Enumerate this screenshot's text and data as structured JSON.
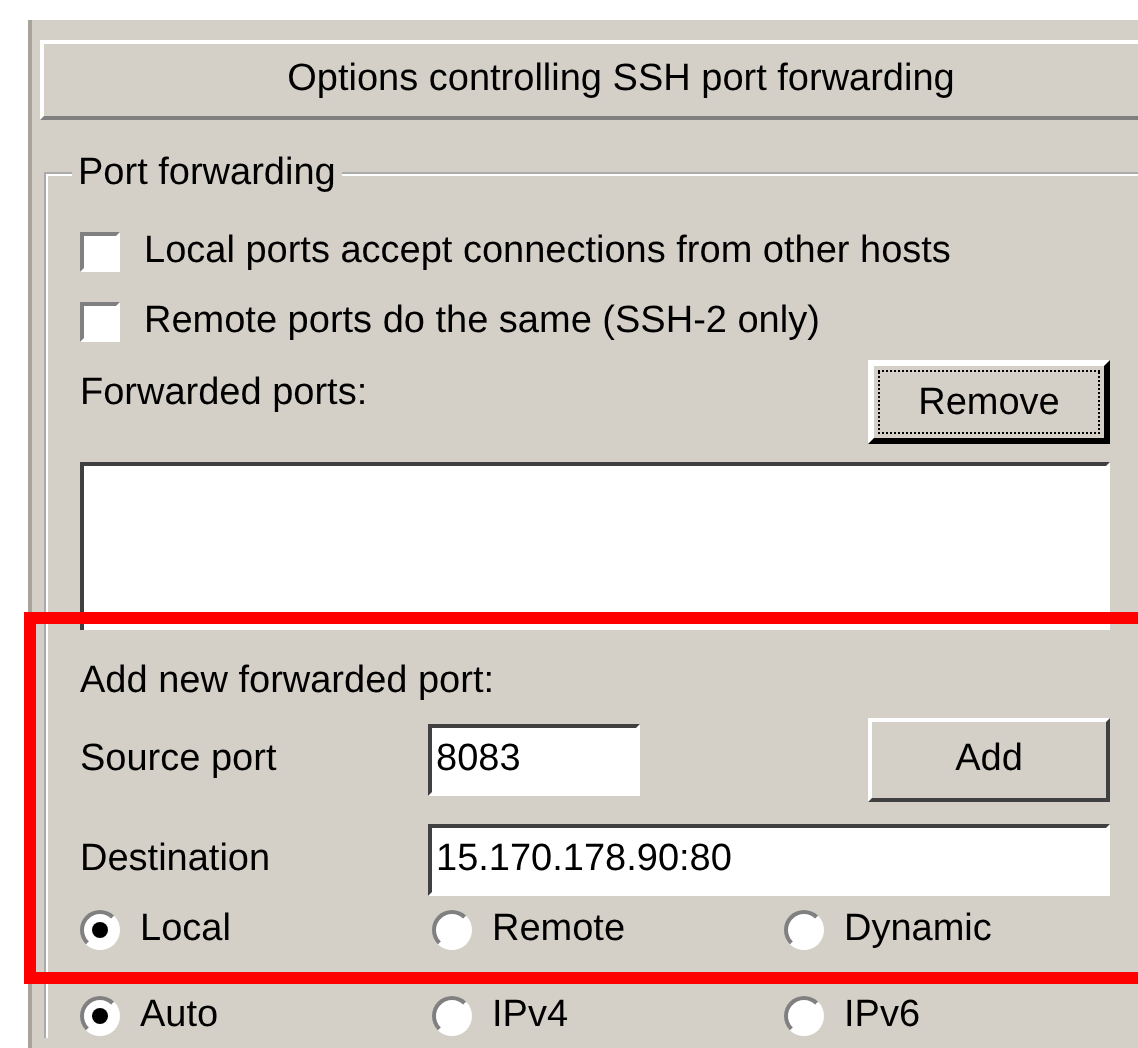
{
  "header": {
    "title": "Options controlling SSH port forwarding"
  },
  "port_forwarding": {
    "legend": "Port forwarding",
    "checkboxes": [
      {
        "label": "Local ports accept connections from other hosts",
        "checked": false
      },
      {
        "label": "Remote ports do the same (SSH-2 only)",
        "checked": false
      }
    ],
    "forwarded_ports_label": "Forwarded ports:",
    "remove_button": {
      "label": "Remove",
      "focused": true
    },
    "add_section": {
      "title": "Add new forwarded port:",
      "source_port": {
        "label": "Source port",
        "value": "8083"
      },
      "add_button": {
        "label": "Add"
      },
      "destination": {
        "label": "Destination",
        "value": "15.170.178.90:80"
      },
      "direction": [
        {
          "label": "Local",
          "selected": true
        },
        {
          "label": "Remote",
          "selected": false
        },
        {
          "label": "Dynamic",
          "selected": false
        }
      ]
    },
    "protocol": [
      {
        "label": "Auto",
        "selected": true
      },
      {
        "label": "IPv4",
        "selected": false
      },
      {
        "label": "IPv6",
        "selected": false
      }
    ]
  }
}
